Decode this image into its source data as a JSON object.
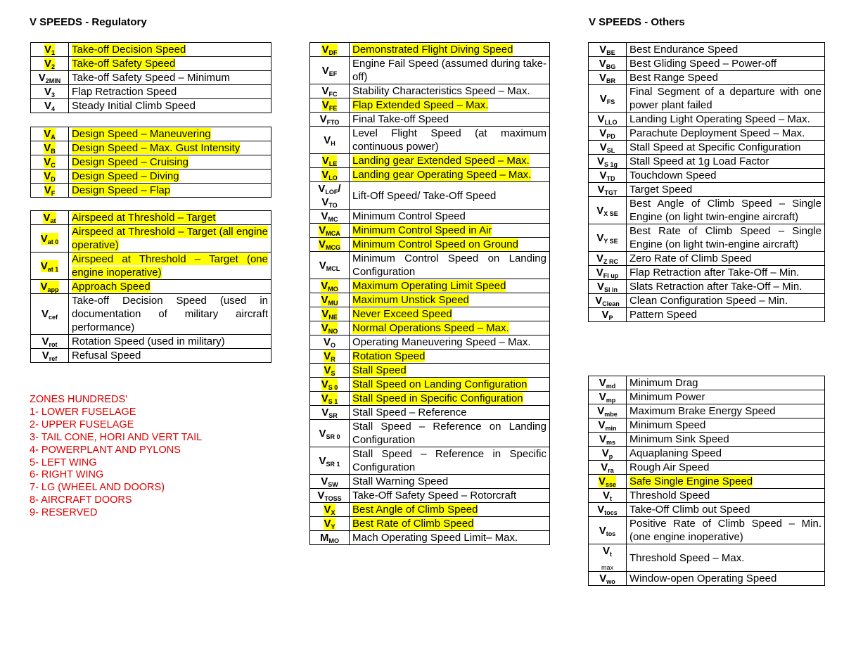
{
  "headings": {
    "regulatory": "V SPEEDS - Regulatory",
    "others": "V SPEEDS - Others"
  },
  "highlight_color": "#ffff00",
  "zones_color": "#e00000",
  "regulatory_tables": [
    {
      "rows": [
        {
          "base": "V",
          "sub": "1",
          "desc": "Take-off Decision Speed",
          "highlight": true
        },
        {
          "base": "V",
          "sub": "2",
          "desc": "Take-off Safety Speed",
          "highlight": true
        },
        {
          "base": "V",
          "sub": "2MIN",
          "desc": "Take-off Safety Speed – Minimum",
          "highlight": false
        },
        {
          "base": "V",
          "sub": "3",
          "desc": "Flap Retraction Speed",
          "highlight": false
        },
        {
          "base": "V",
          "sub": "4",
          "desc": "Steady Initial Climb Speed",
          "highlight": false
        }
      ]
    },
    {
      "rows": [
        {
          "base": "V",
          "sub": "A",
          "desc": "Design Speed – Maneuvering",
          "highlight": true
        },
        {
          "base": "V",
          "sub": "B",
          "desc": "Design Speed – Max. Gust Intensity",
          "highlight": true
        },
        {
          "base": "V",
          "sub": "C",
          "desc": "Design Speed – Cruising",
          "highlight": true
        },
        {
          "base": "V",
          "sub": "D",
          "desc": "Design Speed – Diving",
          "highlight": true
        },
        {
          "base": "V",
          "sub": "F",
          "desc": "Design Speed – Flap",
          "highlight": true
        }
      ]
    },
    {
      "rows": [
        {
          "base": "V",
          "sub": "at",
          "desc": "Airspeed at Threshold – Target",
          "highlight": true
        },
        {
          "base": "V",
          "sub": "at 0",
          "desc": "Airspeed at Threshold – Target (all engine operative)",
          "highlight": true
        },
        {
          "base": "V",
          "sub": "at 1",
          "desc": "Airspeed at Threshold – Target (one engine inoperative)",
          "highlight": true
        },
        {
          "base": "V",
          "sub": "app",
          "desc": "Approach Speed",
          "highlight": true
        },
        {
          "base": "V",
          "sub": "cef",
          "desc": "Take-off Decision Speed (used in documentation of military aircraft performance)",
          "highlight": false
        },
        {
          "base": "V",
          "sub": "rot",
          "desc": "Rotation Speed (used in military)",
          "highlight": false
        },
        {
          "base": "V",
          "sub": "ref",
          "desc": "Refusal Speed",
          "highlight": false
        }
      ]
    },
    {
      "rows": [
        {
          "base": "V",
          "sub": "DF",
          "desc": "Demonstrated Flight Diving Speed",
          "highlight": true
        },
        {
          "base": "V",
          "sub": "EF",
          "desc": "Engine Fail Speed (assumed during take-off)",
          "highlight": false
        },
        {
          "base": "V",
          "sub": "FC",
          "desc": "Stability Characteristics Speed – Max.",
          "highlight": false
        },
        {
          "base": "V",
          "sub": "FE",
          "desc": "Flap Extended Speed – Max.",
          "highlight": true
        },
        {
          "base": "V",
          "sub": "FTO",
          "desc": "Final Take-off Speed",
          "highlight": false
        },
        {
          "base": "V",
          "sub": "H",
          "desc": "Level Flight Speed (at maximum continuous power)",
          "highlight": false
        },
        {
          "base": "V",
          "sub": "LE",
          "desc": "Landing gear Extended Speed – Max.",
          "highlight": true
        },
        {
          "base": "V",
          "sub": "LO",
          "desc": "Landing gear Operating Speed – Max.",
          "highlight": true
        },
        {
          "base": "V",
          "sub": "LOF",
          "extra": "/ V",
          "sub2": "TO",
          "desc": "Lift-Off Speed/ Take-Off Speed",
          "highlight": false
        },
        {
          "base": "V",
          "sub": "MC",
          "desc": "Minimum Control Speed",
          "highlight": false
        },
        {
          "base": "V",
          "sub": "MCA",
          "desc": "Minimum Control Speed in Air",
          "highlight": true
        },
        {
          "base": "V",
          "sub": "MCG",
          "desc": "Minimum Control Speed on Ground",
          "highlight": true
        },
        {
          "base": "V",
          "sub": "MCL",
          "desc": "Minimum Control Speed on Landing Configuration",
          "highlight": false
        },
        {
          "base": "V",
          "sub": "MO",
          "desc": "Maximum Operating Limit Speed",
          "highlight": true
        },
        {
          "base": "V",
          "sub": "MU",
          "desc": "Maximum Unstick Speed",
          "highlight": true
        },
        {
          "base": "V",
          "sub": "NE",
          "desc": "Never Exceed Speed",
          "highlight": true
        },
        {
          "base": "V",
          "sub": "NO",
          "desc": "Normal Operations Speed – Max.",
          "highlight": true
        },
        {
          "base": "V",
          "sub": "O",
          "desc": "Operating Maneuvering Speed – Max.",
          "highlight": false
        },
        {
          "base": "V",
          "sub": "R",
          "desc": "Rotation Speed",
          "highlight": true
        },
        {
          "base": "V",
          "sub": "S",
          "desc": "Stall Speed",
          "highlight": true
        },
        {
          "base": "V",
          "sub": "S 0",
          "desc": "Stall Speed on Landing Configuration",
          "highlight": true
        },
        {
          "base": "V",
          "sub": "S 1",
          "desc": "Stall Speed in Specific Configuration",
          "highlight": true
        },
        {
          "base": "V",
          "sub": "SR",
          "desc": "Stall Speed – Reference",
          "highlight": false
        },
        {
          "base": "V",
          "sub": "SR 0",
          "desc": "Stall Speed – Reference on Landing Configuration",
          "highlight": false
        },
        {
          "base": "V",
          "sub": "SR 1",
          "desc": "Stall Speed – Reference in Specific Configuration",
          "highlight": false
        },
        {
          "base": "V",
          "sub": "SW",
          "desc": "Stall Warning Speed",
          "highlight": false
        },
        {
          "base": "V",
          "sub": "TOSS",
          "desc": "Take-Off Safety Speed – Rotorcraft",
          "highlight": false
        },
        {
          "base": "V",
          "sub": "X",
          "desc": "Best Angle of Climb Speed",
          "highlight": true
        },
        {
          "base": "V",
          "sub": "Y",
          "desc": "Best Rate of Climb Speed",
          "highlight": true
        },
        {
          "base": "M",
          "sub": "MO",
          "desc": "Mach Operating Speed Limit– Max.",
          "highlight": false
        }
      ]
    }
  ],
  "others_tables": [
    {
      "rows": [
        {
          "base": "V",
          "sub": "BE",
          "desc": "Best Endurance Speed",
          "highlight": false
        },
        {
          "base": "V",
          "sub": "BG",
          "desc": "Best Gliding Speed – Power-off",
          "highlight": false
        },
        {
          "base": "V",
          "sub": "BR",
          "desc": "Best Range Speed",
          "highlight": false
        },
        {
          "base": "V",
          "sub": "FS",
          "desc": "Final Segment of a departure with one power plant failed",
          "highlight": false
        },
        {
          "base": "V",
          "sub": "LLO",
          "desc": "Landing Light Operating Speed – Max.",
          "highlight": false
        },
        {
          "base": "V",
          "sub": "PD",
          "desc": "Parachute Deployment Speed – Max.",
          "highlight": false
        },
        {
          "base": "V",
          "sub": "SL",
          "desc": "Stall Speed at Specific Configuration",
          "highlight": false
        },
        {
          "base": "V",
          "sub": "S 1g",
          "desc": "Stall Speed at 1g Load Factor",
          "highlight": false
        },
        {
          "base": "V",
          "sub": "TD",
          "desc": "Touchdown Speed",
          "highlight": false
        },
        {
          "base": "V",
          "sub": "TGT",
          "desc": "Target Speed",
          "highlight": false
        },
        {
          "base": "V",
          "sub": "X SE",
          "desc": "Best Angle of Climb Speed – Single Engine (on light twin-engine aircraft)",
          "highlight": false
        },
        {
          "base": "V",
          "sub": "Y SE",
          "desc": "Best Rate of Climb Speed – Single Engine (on light twin-engine aircraft)",
          "highlight": false
        },
        {
          "base": "V",
          "sub": "Z RC",
          "desc": "Zero Rate of Climb Speed",
          "highlight": false
        },
        {
          "base": "V",
          "sub": "Fl up",
          "desc": "Flap Retraction after Take-Off – Min.",
          "highlight": false
        },
        {
          "base": "V",
          "sub": "Sl in",
          "desc": "Slats Retraction after Take-Off – Min.",
          "highlight": false
        },
        {
          "base": "V",
          "sub": "Clean",
          "desc": "Clean Configuration Speed – Min.",
          "highlight": false
        },
        {
          "base": "V",
          "sub": "P",
          "desc": "Pattern Speed",
          "highlight": false
        }
      ]
    },
    {
      "rows": [
        {
          "base": "V",
          "sub": "md",
          "desc": "Minimum Drag",
          "highlight": false
        },
        {
          "base": "V",
          "sub": "mp",
          "desc": "Minimum Power",
          "highlight": false
        },
        {
          "base": "V",
          "sub": "mbe",
          "desc": "Maximum Brake Energy Speed",
          "highlight": false
        },
        {
          "base": "V",
          "sub": "min",
          "desc": "Minimum Speed",
          "highlight": false
        },
        {
          "base": "V",
          "sub": "ms",
          "desc": "Minimum Sink Speed",
          "highlight": false
        },
        {
          "base": "V",
          "sub": "p",
          "desc": "Aquaplaning Speed",
          "highlight": false
        },
        {
          "base": "V",
          "sub": "ra",
          "desc": "Rough Air Speed",
          "highlight": false
        },
        {
          "base": "V",
          "sub": "sse",
          "desc": "Safe Single Engine Speed",
          "highlight": true
        },
        {
          "base": "V",
          "sub": "t",
          "desc": "Threshold Speed",
          "highlight": false
        },
        {
          "base": "V",
          "sub": "tocs",
          "desc": "Take-Off Climb out Speed",
          "highlight": false
        },
        {
          "base": "V",
          "sub": "tos",
          "desc": "Positive Rate of Climb Speed – Min. (one engine inoperative)",
          "highlight": false
        },
        {
          "base": "V",
          "sub": "t",
          "extra": "",
          "sub2": "max",
          "desc": "Threshold Speed – Max.",
          "highlight": false
        },
        {
          "base": "V",
          "sub": "wo",
          "desc": "Window-open Operating Speed",
          "highlight": false
        }
      ]
    }
  ],
  "zones": {
    "title": "ZONES HUNDREDS'",
    "items": [
      "1- LOWER FUSELAGE",
      "2- UPPER FUSELAGE",
      "3- TAIL CONE, HORI AND VERT TAIL",
      "4- POWERPLANT AND PYLONS",
      "5- LEFT WING",
      "6- RIGHT WING",
      "7- LG (WHEEL AND DOORS)",
      "8- AIRCRAFT DOORS",
      "9- RESERVED"
    ]
  }
}
